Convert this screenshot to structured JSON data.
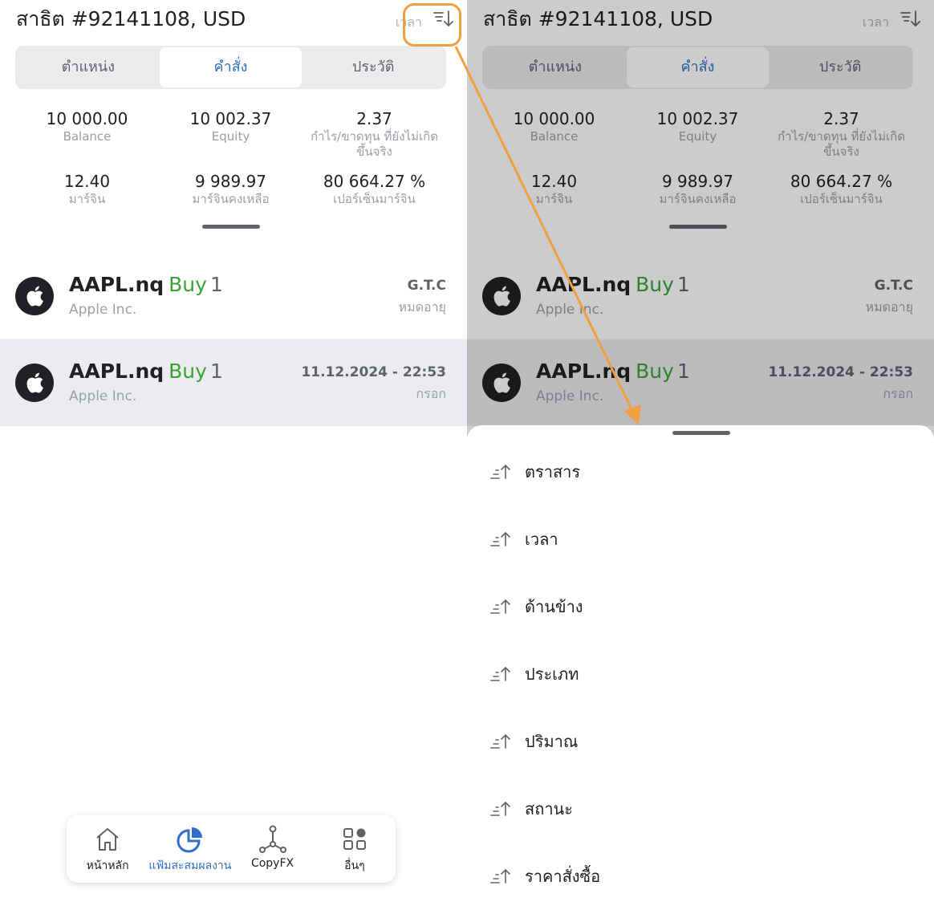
{
  "header": {
    "account_title": "สาธิต #92141108, USD",
    "sort_label": "เวลา"
  },
  "tabs": [
    {
      "label": "ตำแหน่ง",
      "active": false
    },
    {
      "label": "คำสั่ง",
      "active": true
    },
    {
      "label": "ประวัติ",
      "active": false
    }
  ],
  "stats": [
    {
      "value": "10 000.00",
      "label": "Balance"
    },
    {
      "value": "10 002.37",
      "label": "Equity"
    },
    {
      "value": "2.37",
      "label": "กำไร/ขาดทุน ที่ยังไม่เกิดขึ้นจริง"
    },
    {
      "value": "12.40",
      "label": "มาร์จิน"
    },
    {
      "value": "9 989.97",
      "label": "มาร์จินคงเหลือ"
    },
    {
      "value": "80 664.27 %",
      "label": "เปอร์เซ็นมาร์จิน"
    }
  ],
  "orders": [
    {
      "symbol": "AAPL.nq",
      "side": "Buy",
      "volume": "1",
      "company": "Apple Inc.",
      "expiry": "G.T.C",
      "expiry_sub": "หมดอายุ"
    },
    {
      "symbol": "AAPL.nq",
      "side": "Buy",
      "volume": "1",
      "company": "Apple Inc.",
      "expiry": "11.12.2024 - 22:53",
      "expiry_sub": "กรอก"
    }
  ],
  "bottom_nav": [
    {
      "label": "หน้าหลัก",
      "icon": "home-icon",
      "active": false
    },
    {
      "label": "แฟ้มสะสมผลงาน",
      "icon": "portfolio-pie-icon",
      "active": true
    },
    {
      "label": "CopyFX",
      "icon": "copyfx-network-icon",
      "active": false
    },
    {
      "label": "อื่นๆ",
      "icon": "grid-more-icon",
      "active": false
    }
  ],
  "sort_options": [
    {
      "label": "ตราสาร"
    },
    {
      "label": "เวลา"
    },
    {
      "label": "ด้านข้าง"
    },
    {
      "label": "ประเภท"
    },
    {
      "label": "ปริมาณ"
    },
    {
      "label": "สถานะ"
    },
    {
      "label": "ราคาสั่งซื้อ"
    }
  ],
  "colors": {
    "accent": "#2f6fc6",
    "buy": "#3aa335",
    "annotation": "#f0a040"
  }
}
